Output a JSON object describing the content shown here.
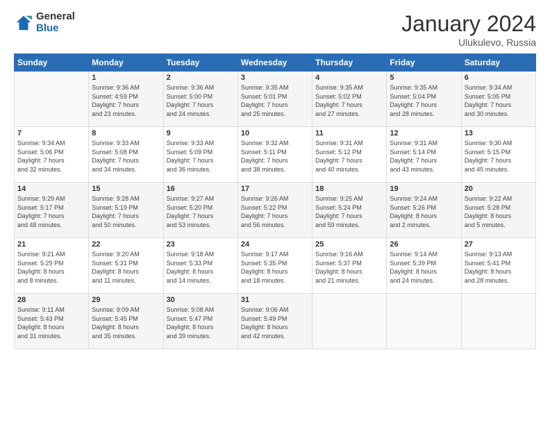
{
  "header": {
    "logo_general": "General",
    "logo_blue": "Blue",
    "month_year": "January 2024",
    "location": "Ulukulevo, Russia"
  },
  "days_of_week": [
    "Sunday",
    "Monday",
    "Tuesday",
    "Wednesday",
    "Thursday",
    "Friday",
    "Saturday"
  ],
  "weeks": [
    [
      {
        "day": "",
        "content": ""
      },
      {
        "day": "1",
        "content": "Sunrise: 9:36 AM\nSunset: 4:59 PM\nDaylight: 7 hours\nand 23 minutes."
      },
      {
        "day": "2",
        "content": "Sunrise: 9:36 AM\nSunset: 5:00 PM\nDaylight: 7 hours\nand 24 minutes."
      },
      {
        "day": "3",
        "content": "Sunrise: 9:35 AM\nSunset: 5:01 PM\nDaylight: 7 hours\nand 25 minutes."
      },
      {
        "day": "4",
        "content": "Sunrise: 9:35 AM\nSunset: 5:02 PM\nDaylight: 7 hours\nand 27 minutes."
      },
      {
        "day": "5",
        "content": "Sunrise: 9:35 AM\nSunset: 5:04 PM\nDaylight: 7 hours\nand 28 minutes."
      },
      {
        "day": "6",
        "content": "Sunrise: 9:34 AM\nSunset: 5:05 PM\nDaylight: 7 hours\nand 30 minutes."
      }
    ],
    [
      {
        "day": "7",
        "content": "Sunrise: 9:34 AM\nSunset: 5:06 PM\nDaylight: 7 hours\nand 32 minutes."
      },
      {
        "day": "8",
        "content": "Sunrise: 9:33 AM\nSunset: 5:08 PM\nDaylight: 7 hours\nand 34 minutes."
      },
      {
        "day": "9",
        "content": "Sunrise: 9:33 AM\nSunset: 5:09 PM\nDaylight: 7 hours\nand 36 minutes."
      },
      {
        "day": "10",
        "content": "Sunrise: 9:32 AM\nSunset: 5:11 PM\nDaylight: 7 hours\nand 38 minutes."
      },
      {
        "day": "11",
        "content": "Sunrise: 9:31 AM\nSunset: 5:12 PM\nDaylight: 7 hours\nand 40 minutes."
      },
      {
        "day": "12",
        "content": "Sunrise: 9:31 AM\nSunset: 5:14 PM\nDaylight: 7 hours\nand 43 minutes."
      },
      {
        "day": "13",
        "content": "Sunrise: 9:30 AM\nSunset: 5:15 PM\nDaylight: 7 hours\nand 45 minutes."
      }
    ],
    [
      {
        "day": "14",
        "content": "Sunrise: 9:29 AM\nSunset: 5:17 PM\nDaylight: 7 hours\nand 48 minutes."
      },
      {
        "day": "15",
        "content": "Sunrise: 9:28 AM\nSunset: 5:19 PM\nDaylight: 7 hours\nand 50 minutes."
      },
      {
        "day": "16",
        "content": "Sunrise: 9:27 AM\nSunset: 5:20 PM\nDaylight: 7 hours\nand 53 minutes."
      },
      {
        "day": "17",
        "content": "Sunrise: 9:26 AM\nSunset: 5:22 PM\nDaylight: 7 hours\nand 56 minutes."
      },
      {
        "day": "18",
        "content": "Sunrise: 9:25 AM\nSunset: 5:24 PM\nDaylight: 7 hours\nand 59 minutes."
      },
      {
        "day": "19",
        "content": "Sunrise: 9:24 AM\nSunset: 5:26 PM\nDaylight: 8 hours\nand 2 minutes."
      },
      {
        "day": "20",
        "content": "Sunrise: 9:22 AM\nSunset: 5:28 PM\nDaylight: 8 hours\nand 5 minutes."
      }
    ],
    [
      {
        "day": "21",
        "content": "Sunrise: 9:21 AM\nSunset: 5:29 PM\nDaylight: 8 hours\nand 8 minutes."
      },
      {
        "day": "22",
        "content": "Sunrise: 9:20 AM\nSunset: 5:31 PM\nDaylight: 8 hours\nand 11 minutes."
      },
      {
        "day": "23",
        "content": "Sunrise: 9:18 AM\nSunset: 5:33 PM\nDaylight: 8 hours\nand 14 minutes."
      },
      {
        "day": "24",
        "content": "Sunrise: 9:17 AM\nSunset: 5:35 PM\nDaylight: 8 hours\nand 18 minutes."
      },
      {
        "day": "25",
        "content": "Sunrise: 9:16 AM\nSunset: 5:37 PM\nDaylight: 8 hours\nand 21 minutes."
      },
      {
        "day": "26",
        "content": "Sunrise: 9:14 AM\nSunset: 5:39 PM\nDaylight: 8 hours\nand 24 minutes."
      },
      {
        "day": "27",
        "content": "Sunrise: 9:13 AM\nSunset: 5:41 PM\nDaylight: 8 hours\nand 28 minutes."
      }
    ],
    [
      {
        "day": "28",
        "content": "Sunrise: 9:11 AM\nSunset: 5:43 PM\nDaylight: 8 hours\nand 31 minutes."
      },
      {
        "day": "29",
        "content": "Sunrise: 9:09 AM\nSunset: 5:45 PM\nDaylight: 8 hours\nand 35 minutes."
      },
      {
        "day": "30",
        "content": "Sunrise: 9:08 AM\nSunset: 5:47 PM\nDaylight: 8 hours\nand 39 minutes."
      },
      {
        "day": "31",
        "content": "Sunrise: 9:06 AM\nSunset: 5:49 PM\nDaylight: 8 hours\nand 42 minutes."
      },
      {
        "day": "",
        "content": ""
      },
      {
        "day": "",
        "content": ""
      },
      {
        "day": "",
        "content": ""
      }
    ]
  ]
}
